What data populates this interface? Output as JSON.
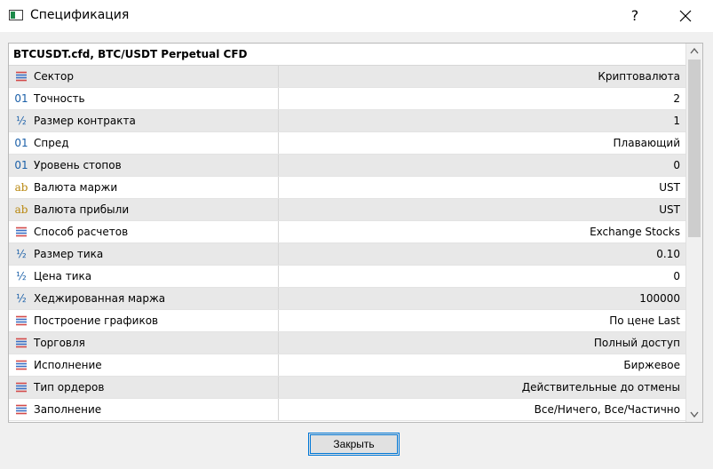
{
  "window": {
    "title": "Спецификация",
    "help_label": "?",
    "close_icon": "close-icon"
  },
  "table": {
    "header": "BTCUSDT.cfd, BTC/USDT Perpetual CFD",
    "rows": [
      {
        "icon": "list-icon",
        "label": "Сектор",
        "value": "Криптовалюта"
      },
      {
        "icon": "digits-icon",
        "label": "Точность",
        "value": "2"
      },
      {
        "icon": "fraction-icon",
        "label": "Размер контракта",
        "value": "1"
      },
      {
        "icon": "digits-icon",
        "label": "Спред",
        "value": "Плавающий"
      },
      {
        "icon": "digits-icon",
        "label": "Уровень стопов",
        "value": "0"
      },
      {
        "icon": "text-icon",
        "label": "Валюта маржи",
        "value": "UST"
      },
      {
        "icon": "text-icon",
        "label": "Валюта прибыли",
        "value": "UST"
      },
      {
        "icon": "list-icon",
        "label": "Способ расчетов",
        "value": "Exchange Stocks"
      },
      {
        "icon": "fraction-icon",
        "label": "Размер тика",
        "value": "0.10"
      },
      {
        "icon": "fraction-icon",
        "label": "Цена тика",
        "value": "0"
      },
      {
        "icon": "fraction-icon",
        "label": "Хеджированная маржа",
        "value": "100000"
      },
      {
        "icon": "list-icon",
        "label": "Построение графиков",
        "value": "По цене Last"
      },
      {
        "icon": "list-icon",
        "label": "Торговля",
        "value": "Полный доступ"
      },
      {
        "icon": "list-icon",
        "label": "Исполнение",
        "value": "Биржевое"
      },
      {
        "icon": "list-icon",
        "label": "Тип ордеров",
        "value": "Действительные до отмены"
      },
      {
        "icon": "list-icon",
        "label": "Заполнение",
        "value": "Все/Ничего, Все/Частично"
      }
    ]
  },
  "icon_glyphs": {
    "digits": "01",
    "text": "ab",
    "fraction": "½"
  },
  "footer": {
    "close_button_label": "Закрыть"
  },
  "colors": {
    "accent": "#0078d7",
    "list_icon_blue": "#3a6fc4",
    "list_icon_red": "#d24a4a",
    "digits_icon": "#1a5fa8",
    "text_icon": "#b8860b"
  }
}
